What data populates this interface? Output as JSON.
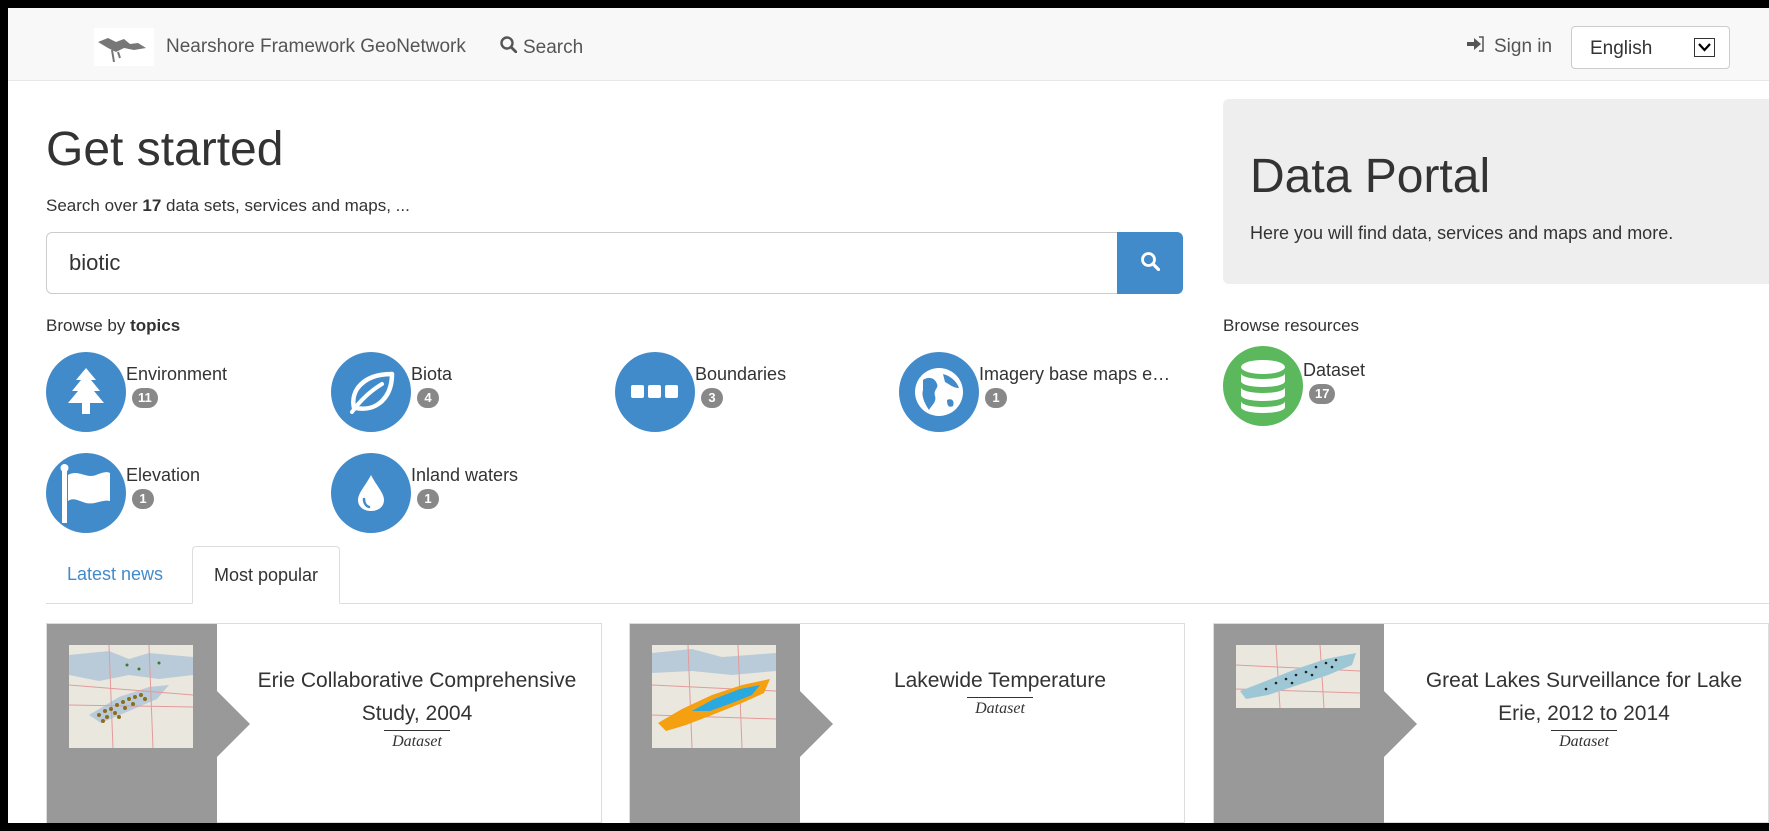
{
  "navbar": {
    "brand": "Nearshore Framework GeoNetwork",
    "search_label": "Search",
    "signin_label": "Sign in",
    "language": "English"
  },
  "hero": {
    "title": "Get started",
    "subtitle_prefix": "Search over ",
    "subtitle_count": "17",
    "subtitle_suffix": " data sets, services and maps, ...",
    "search_value": "biotic"
  },
  "topics": {
    "heading_prefix": "Browse by ",
    "heading_bold": "topics",
    "items": [
      {
        "label": "Environment",
        "count": "11",
        "icon": "tree-icon"
      },
      {
        "label": "Biota",
        "count": "4",
        "icon": "leaf-icon"
      },
      {
        "label": "Boundaries",
        "count": "3",
        "icon": "ellipsis-icon"
      },
      {
        "label": "Imagery base maps e…",
        "count": "1",
        "icon": "globe-icon"
      },
      {
        "label": "Elevation",
        "count": "1",
        "icon": "flag-icon"
      },
      {
        "label": "Inland waters",
        "count": "1",
        "icon": "water-drop-icon"
      }
    ]
  },
  "portal": {
    "title": "Data Portal",
    "text": "Here you will find data, services and maps and more."
  },
  "resources": {
    "heading": "Browse resources",
    "items": [
      {
        "label": "Dataset",
        "count": "17",
        "icon": "database-icon"
      }
    ]
  },
  "tabs": [
    {
      "label": "Latest news",
      "active": false
    },
    {
      "label": "Most popular",
      "active": true
    }
  ],
  "cards": [
    {
      "title": "Erie Collaborative Comprehensive Study, 2004",
      "type": "Dataset"
    },
    {
      "title": "Lakewide Temperature",
      "type": "Dataset"
    },
    {
      "title": "Great Lakes Surveillance for Lake Erie, 2012 to 2014",
      "type": "Dataset"
    }
  ],
  "colors": {
    "primary": "#428bca",
    "resource": "#5cb85c",
    "badge": "#888888",
    "card_side": "#999999"
  }
}
